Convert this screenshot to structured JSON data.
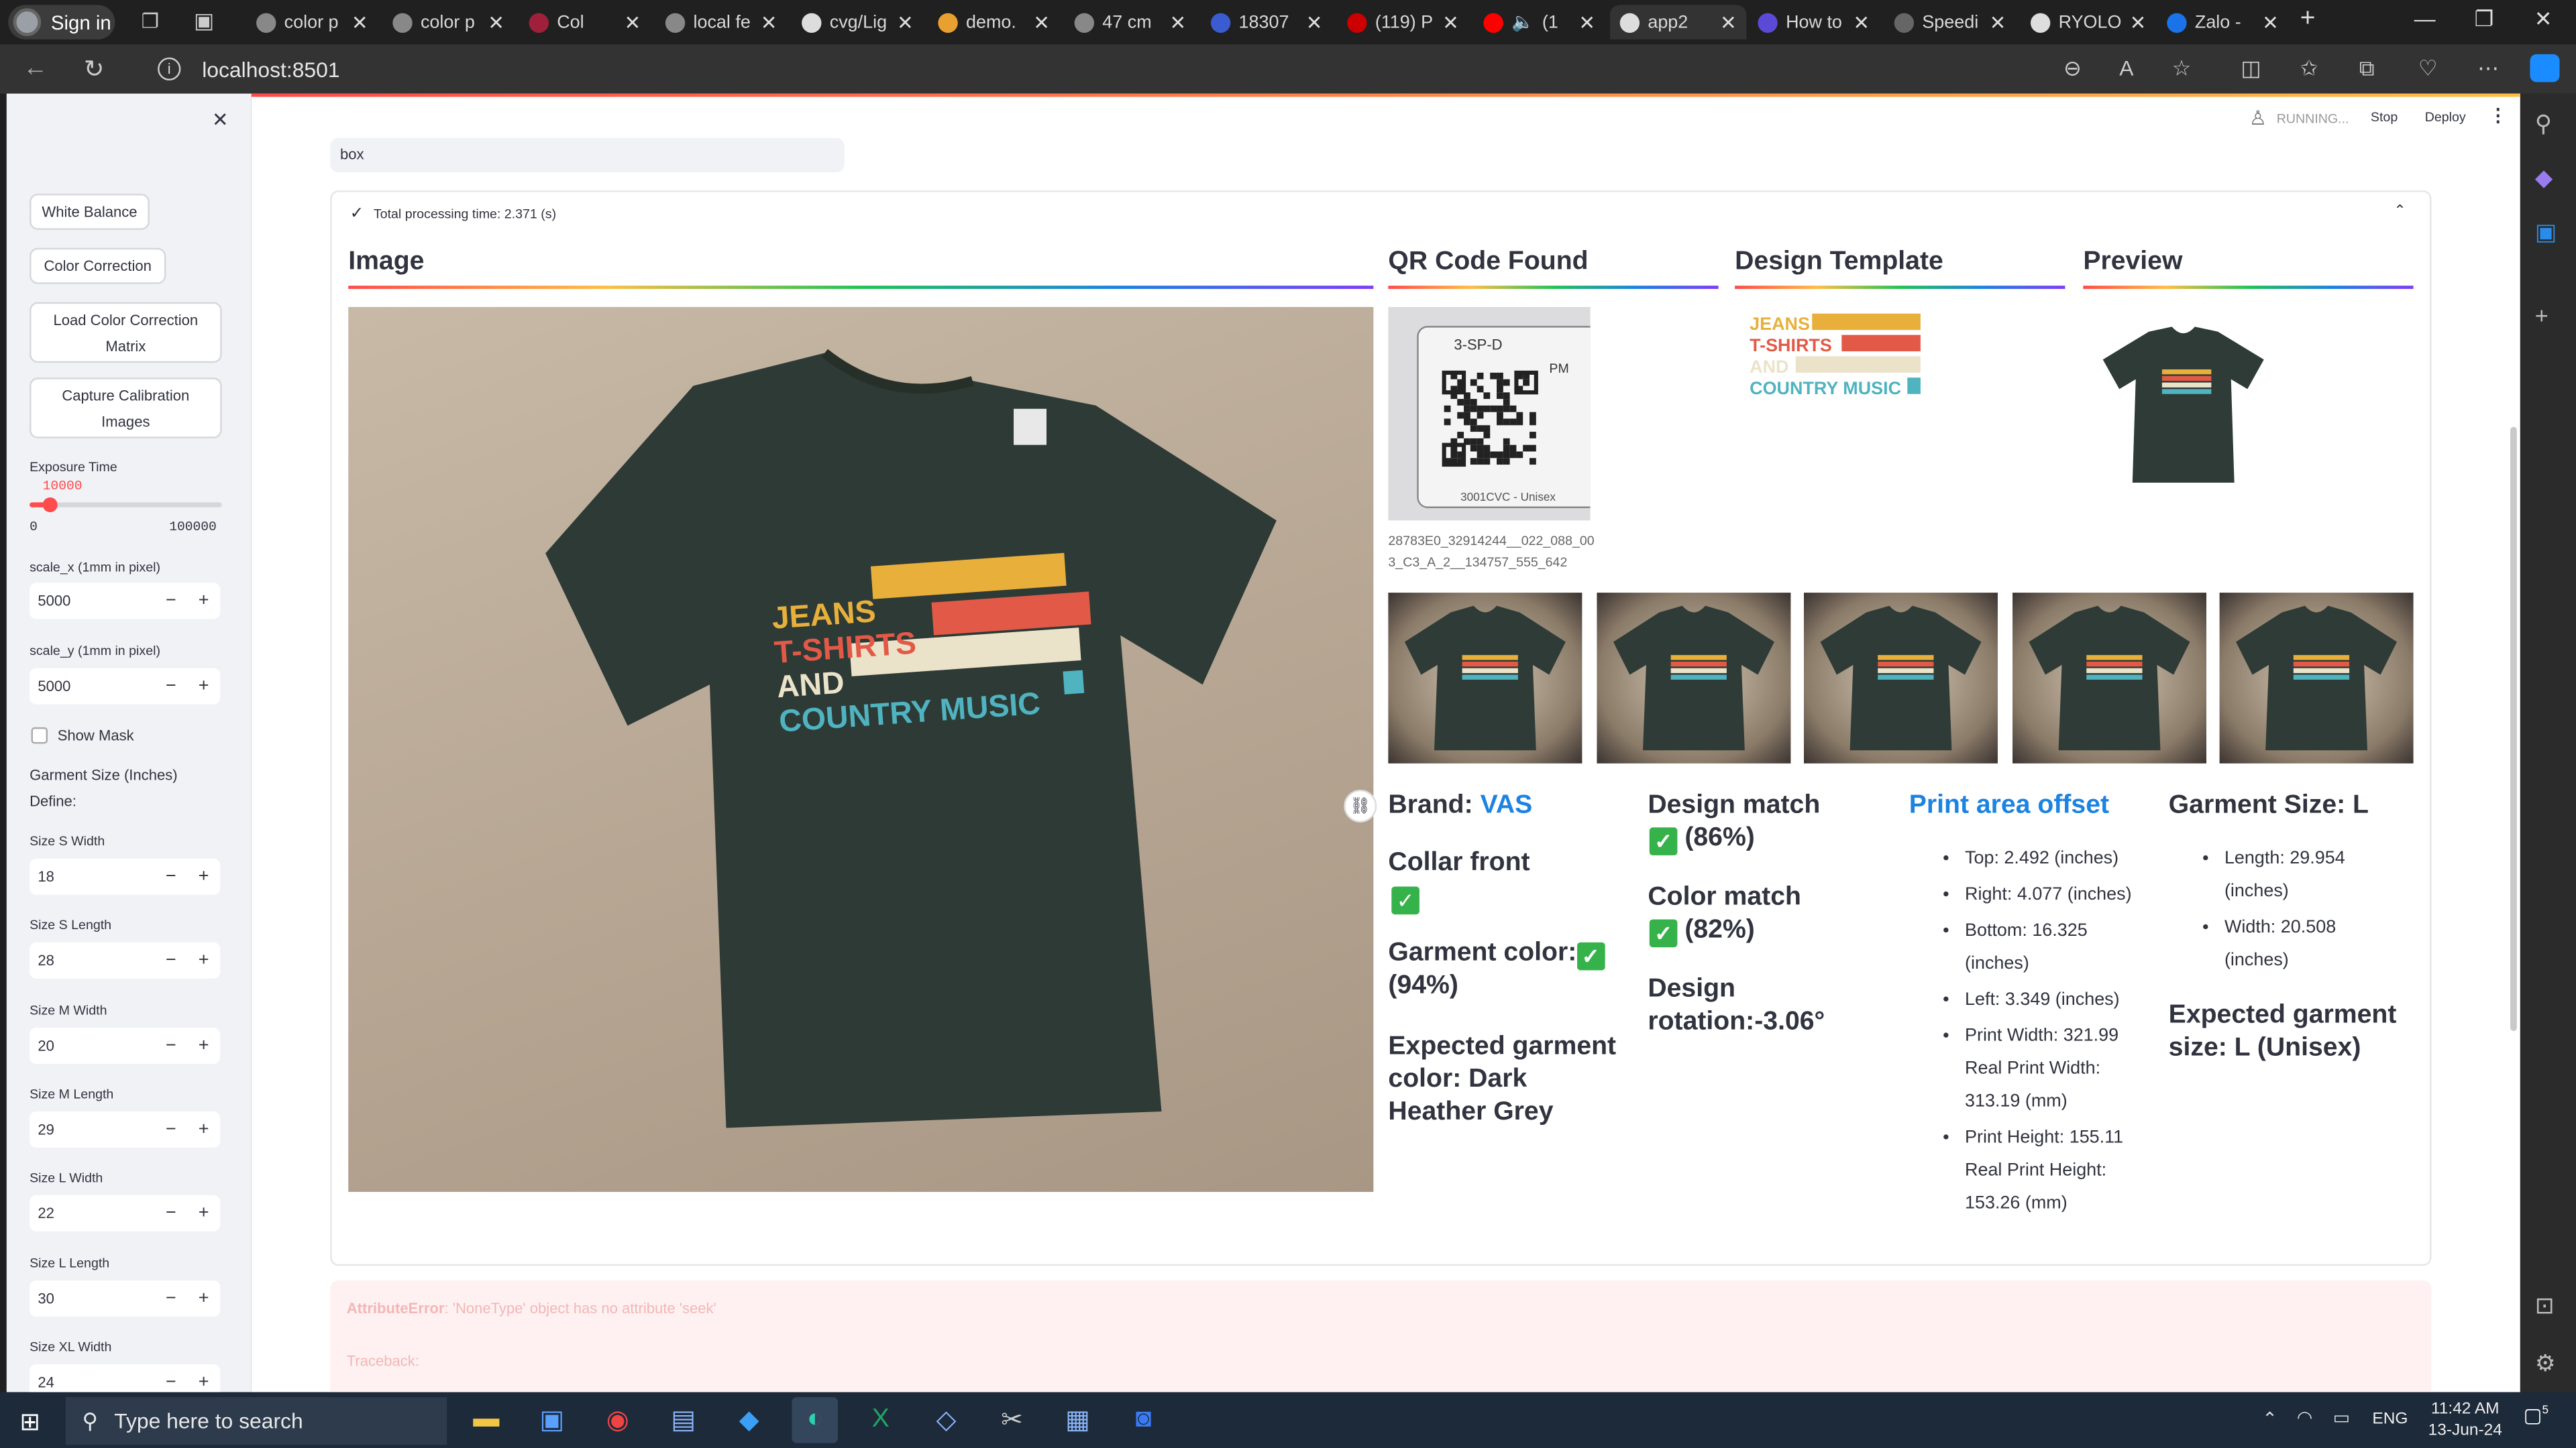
{
  "browser": {
    "signin": "Sign in",
    "tabs": [
      "color p",
      "color p",
      "Col",
      "local fe",
      "cvg/Lig",
      "demo.",
      "47 cm",
      "18307",
      "(119) P",
      "(1",
      "app2",
      "How to",
      "Speedi",
      "RYOLO",
      "Zalo -"
    ],
    "url": "localhost:8501"
  },
  "header": {
    "running": "RUNNING...",
    "stop": "Stop",
    "deploy": "Deploy"
  },
  "sidebar": {
    "buttons": [
      "White Balance",
      "Color Correction",
      "Load Color Correction Matrix",
      "Capture Calibration Images"
    ],
    "exposure": {
      "label": "Exposure Time",
      "value": "10000",
      "min": "0",
      "max": "100000",
      "fraction": 0.1
    },
    "scale_x": {
      "label": "scale_x (1mm in pixel)",
      "value": "5000"
    },
    "scale_y": {
      "label": "scale_y (1mm in pixel)",
      "value": "5000"
    },
    "show_mask": "Show Mask",
    "garment_size": "Garment Size (Inches)",
    "define": "Define:",
    "sizes": [
      {
        "label": "Size S Width",
        "value": "18"
      },
      {
        "label": "Size S Length",
        "value": "28"
      },
      {
        "label": "Size M Width",
        "value": "20"
      },
      {
        "label": "Size M Length",
        "value": "29"
      },
      {
        "label": "Size L Width",
        "value": "22"
      },
      {
        "label": "Size L Length",
        "value": "30"
      },
      {
        "label": "Size XL Width",
        "value": "24"
      }
    ]
  },
  "main": {
    "search_value": "box",
    "status": "Total processing time: 2.371 (s)",
    "headers": {
      "image": "Image",
      "qr": "QR Code Found",
      "design": "Design Template",
      "preview": "Preview"
    },
    "qr_caption": "28783E0_32914244__022_088_003_C3_A_2__134757_555_642",
    "qr_label_top": "3-SP-D",
    "qr_label_pm": "PM",
    "qr_label_bottom": "3001CVC - Unisex",
    "shirt_text": [
      "JEANS",
      "T-SHIRTS",
      "AND",
      "COUNTRY MUSIC"
    ],
    "brand_label": "Brand:",
    "brand_value": "VAS",
    "collar": "Collar front",
    "garment_color": "Garment color:",
    "garment_color_pct": "(94%)",
    "expected_color": "Expected garment color: Dark Heather Grey",
    "design_match": "Design match",
    "design_match_pct": "(86%)",
    "color_match": "Color match",
    "color_match_pct": "(82%)",
    "design_rotation": "Design rotation:-3.06°",
    "print_offset_title": "Print area offset",
    "offsets": [
      "Top: 2.492 (inches)",
      "Right: 4.077 (inches)",
      "Bottom: 16.325 (inches)",
      "Left: 3.349 (inches)",
      "Print Width: 321.99 Real Print Width: 313.19 (mm)",
      "Print Height: 155.11 Real Print Height: 153.26 (mm)"
    ],
    "garment_size_title": "Garment Size: L",
    "garment_dims": [
      "Length: 29.954 (inches)",
      "Width: 20.508 (inches)"
    ],
    "expected_size": "Expected garment size: L (Unisex)",
    "error_type": "AttributeError",
    "error_msg": ": 'NoneType' object has no attribute 'seek'",
    "traceback": "Traceback:"
  },
  "taskbar": {
    "search": "Type here to search",
    "time": "11:42 AM",
    "date": "13-Jun-24",
    "lang": "ENG",
    "notif": "5"
  },
  "colors": {
    "accent": "#ff4b4b",
    "link": "#1c83e1",
    "check": "#36b24a",
    "shirt": "#2e3a36"
  }
}
